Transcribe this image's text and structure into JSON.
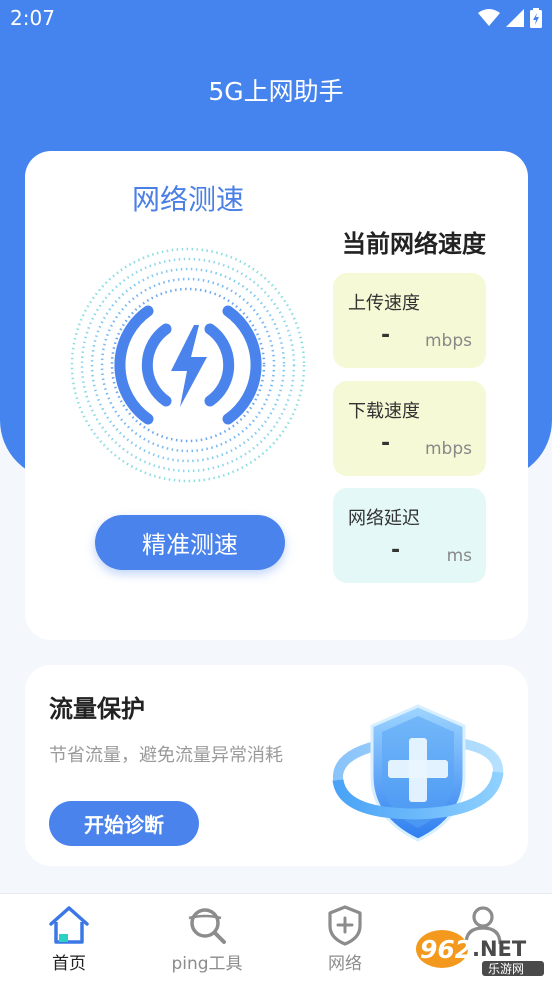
{
  "status_bar": {
    "time": "2:07"
  },
  "app": {
    "title": "5G上网助手"
  },
  "speed_card": {
    "title": "网络测速",
    "accurate_button": "精准测速",
    "current_speed_title": "当前网络速度",
    "stats": [
      {
        "label": "上传速度",
        "value": "-",
        "unit": "mbps"
      },
      {
        "label": "下载速度",
        "value": "-",
        "unit": "mbps"
      },
      {
        "label": "网络延迟",
        "value": "-",
        "unit": "ms"
      }
    ]
  },
  "protect_card": {
    "title": "流量保护",
    "description": "节省流量，避免流量异常消耗",
    "button": "开始诊断"
  },
  "nav": {
    "items": [
      {
        "label": "首页",
        "icon": "home-icon",
        "active": true
      },
      {
        "label": "ping工具",
        "icon": "ping-search-icon",
        "active": false
      },
      {
        "label": "网络",
        "icon": "network-shield-icon",
        "active": false
      },
      {
        "label": "",
        "icon": "user-icon",
        "active": false
      }
    ]
  },
  "watermark": {
    "main": "962",
    "suffix": ".NET",
    "sub": "乐游网"
  },
  "colors": {
    "primary": "#4584ee",
    "button": "#4a83ec",
    "yellow_box": "#f6f9d6",
    "cyan_box": "#e5f8f8"
  }
}
